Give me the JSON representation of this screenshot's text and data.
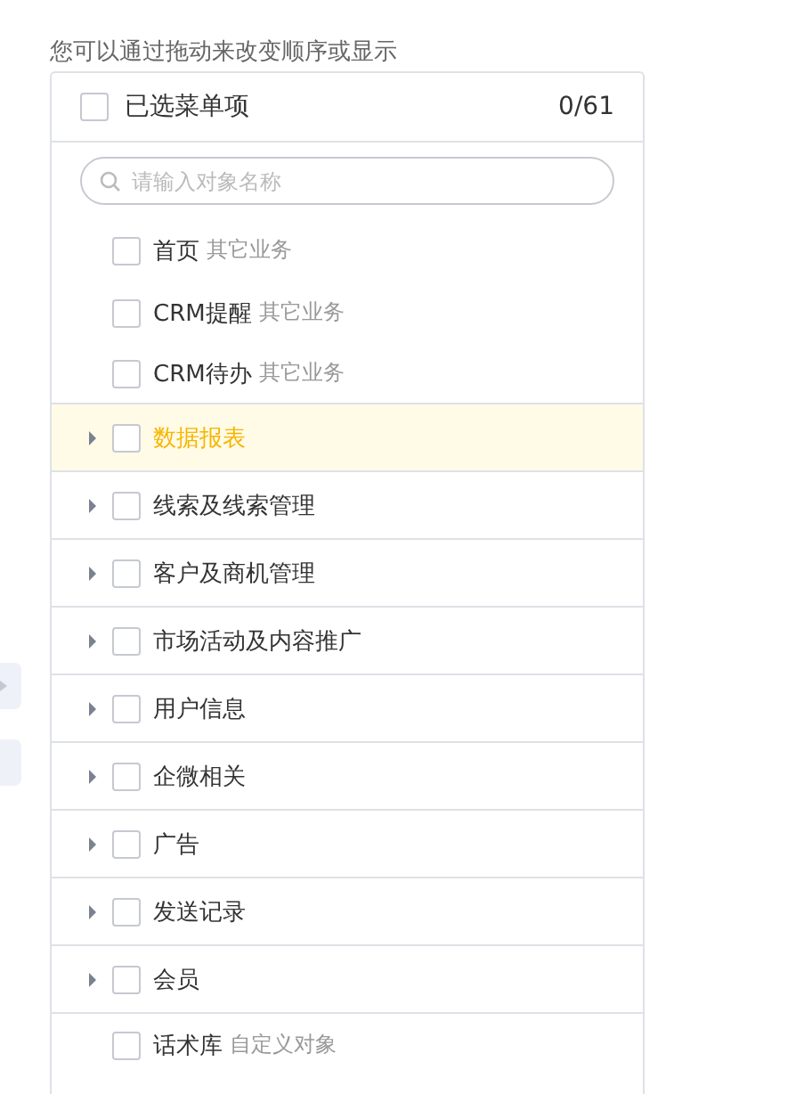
{
  "hint": "您可以通过拖动来改变顺序或显示",
  "header": {
    "label": "已选菜单项",
    "count": "0/61",
    "checked": false
  },
  "search": {
    "placeholder": "请输入对象名称"
  },
  "items": [
    {
      "kind": "leaf",
      "label": "首页",
      "tag": "其它业务",
      "checked": false,
      "selected": false
    },
    {
      "kind": "leaf",
      "label": "CRM提醒",
      "tag": "其它业务",
      "checked": false,
      "selected": false
    },
    {
      "kind": "leaf",
      "label": "CRM待办",
      "tag": "其它业务",
      "checked": false,
      "selected": false
    },
    {
      "kind": "group",
      "label": "数据报表",
      "expanded": false,
      "checked": false,
      "selected": true
    },
    {
      "kind": "group",
      "label": "线索及线索管理",
      "expanded": false,
      "checked": false,
      "selected": false
    },
    {
      "kind": "group",
      "label": "客户及商机管理",
      "expanded": false,
      "checked": false,
      "selected": false
    },
    {
      "kind": "group",
      "label": "市场活动及内容推广",
      "expanded": false,
      "checked": false,
      "selected": false
    },
    {
      "kind": "group",
      "label": "用户信息",
      "expanded": false,
      "checked": false,
      "selected": false
    },
    {
      "kind": "group",
      "label": "企微相关",
      "expanded": false,
      "checked": false,
      "selected": false
    },
    {
      "kind": "group",
      "label": "广告",
      "expanded": false,
      "checked": false,
      "selected": false
    },
    {
      "kind": "group",
      "label": "发送记录",
      "expanded": false,
      "checked": false,
      "selected": false
    },
    {
      "kind": "group",
      "label": "会员",
      "expanded": false,
      "checked": false,
      "selected": false
    },
    {
      "kind": "leaf",
      "label": "话术库",
      "tag": "自定义对象",
      "checked": false,
      "selected": false
    }
  ]
}
